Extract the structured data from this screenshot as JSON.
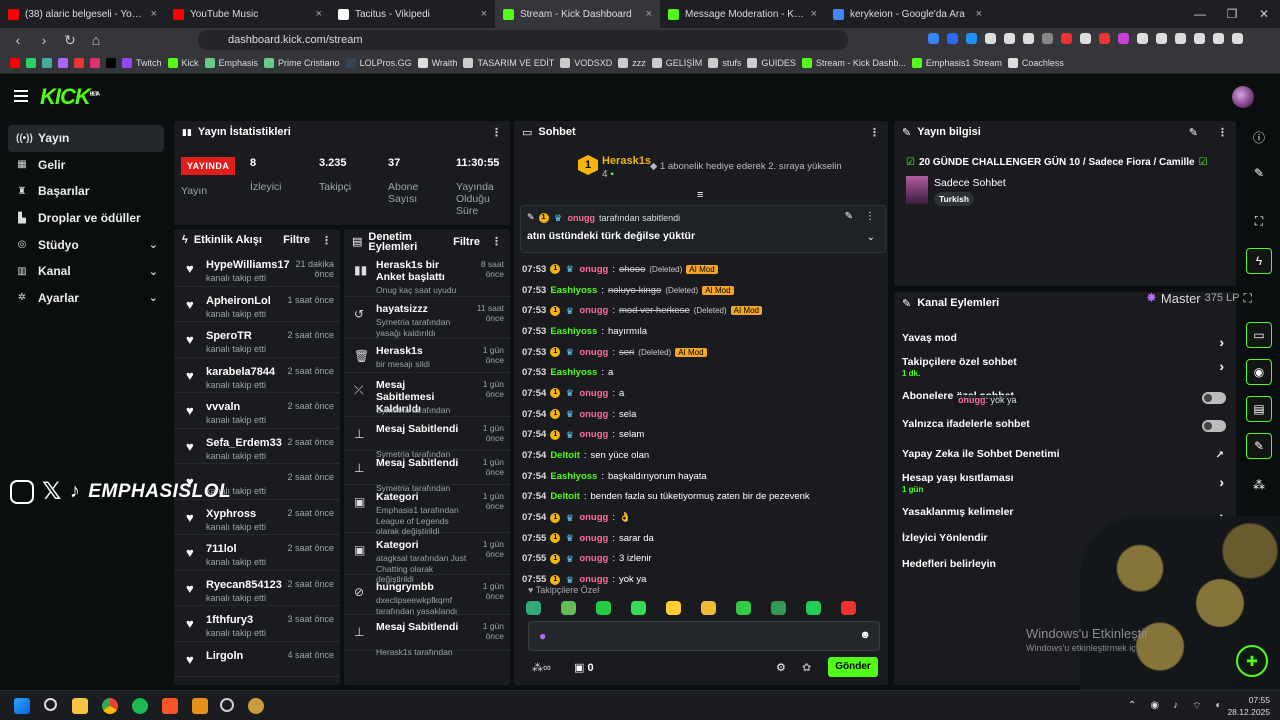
{
  "browser": {
    "tabs": [
      {
        "title": "(38) alaric belgeseli - YouTube",
        "color": "#ff0000"
      },
      {
        "title": "YouTube Music",
        "color": "#ff0000"
      },
      {
        "title": "Tacitus - Vikipedi",
        "color": "#ffffff"
      },
      {
        "title": "Stream - Kick Dashboard",
        "color": "#53fc18"
      },
      {
        "title": "Message Moderation - Kick Dashboard",
        "color": "#53fc18"
      },
      {
        "title": "kerykeion - Google'da Ara",
        "color": "#4285f4"
      }
    ],
    "url": "dashboard.kick.com/stream",
    "bookmarks": [
      "Twitch",
      "Kick",
      "Emphasis",
      "Prime Cristiano",
      "LOLPros.GG",
      "Wraith",
      "TASARIM VE EDİT",
      "VODSXD",
      "zzz",
      "GELİŞİM",
      "stufs",
      "GUIDES",
      "Stream - Kick Dashb...",
      "Emphasis1 Stream",
      "Coachless"
    ]
  },
  "kick": {
    "logo": "KICK",
    "beta": "BETA"
  },
  "sidebar": [
    {
      "label": "Yayın",
      "icon": "broadcast-icon"
    },
    {
      "label": "Gelir",
      "icon": "revenue-icon"
    },
    {
      "label": "Başarılar",
      "icon": "trophy-icon"
    },
    {
      "label": "Droplar ve ödüller",
      "icon": "drops-icon"
    },
    {
      "label": "Stüdyo",
      "icon": "studio-icon"
    },
    {
      "label": "Kanal",
      "icon": "channel-icon"
    },
    {
      "label": "Ayarlar",
      "icon": "gear-icon"
    }
  ],
  "stats": {
    "title": "Yayın İstatistikleri",
    "live_badge": "YAYINDA",
    "live_label": "Yayın",
    "viewers": "8",
    "viewers_label": "İzleyici",
    "followers": "3.235",
    "followers_label": "Takipçi",
    "subs": "37",
    "subs_label": "Abone Sayısı",
    "uptime": "11:30:55",
    "uptime_label": "Yayında Olduğu Süre"
  },
  "activity": {
    "title": "Etkinlik Akışı",
    "filter": "Filtre",
    "rows": [
      {
        "name": "HypeWilliams17",
        "sub": "kanalı takip etti",
        "time": "21 dakika önce"
      },
      {
        "name": "ApheironLol",
        "sub": "kanalı takip etti",
        "time": "1 saat önce"
      },
      {
        "name": "SperoTR",
        "sub": "kanalı takip etti",
        "time": "2 saat önce"
      },
      {
        "name": "karabela7844",
        "sub": "kanalı takip etti",
        "time": "2 saat önce"
      },
      {
        "name": "vvvaln",
        "sub": "kanalı takip etti",
        "time": "2 saat önce"
      },
      {
        "name": "Sefa_Erdem33",
        "sub": "kanalı takip etti",
        "time": "2 saat önce"
      },
      {
        "name": "",
        "sub": "kanalı takip etti",
        "time": "2 saat önce"
      },
      {
        "name": "Xyphross",
        "sub": "kanalı takip etti",
        "time": "2 saat önce"
      },
      {
        "name": "711lol",
        "sub": "kanalı takip etti",
        "time": "2 saat önce"
      },
      {
        "name": "Ryecan854123",
        "sub": "kanalı takip etti",
        "time": "2 saat önce"
      },
      {
        "name": "1fthfury3",
        "sub": "kanalı takip etti",
        "time": "3 saat önce"
      },
      {
        "name": "Lirgoln",
        "sub": "",
        "time": "4 saat önce"
      }
    ]
  },
  "moderation": {
    "title": "Denetim Eylemleri",
    "filter": "Filtre",
    "rows": [
      {
        "icon": "poll-icon",
        "name": "Herask1s bir Anket başlattı",
        "sub": "Onug kaç saat uyudu",
        "time": "8 saat önce"
      },
      {
        "icon": "undo-icon",
        "name": "hayatsizzz",
        "sub": "Symetria tarafından yasağı kaldırıldı",
        "time": "11 saat önce"
      },
      {
        "icon": "trash-icon",
        "name": "Herask1s",
        "sub": "bir mesajı sildi",
        "time": "1 gün önce"
      },
      {
        "icon": "unpin-icon",
        "name": "Mesaj Sabitlemesi Kaldırıldı",
        "sub": "Symetria tarafından",
        "time": "1 gün önce"
      },
      {
        "icon": "pin-icon",
        "name": "Mesaj Sabitlendi",
        "sub": "Symetria tarafından",
        "time": "1 gün önce"
      },
      {
        "icon": "pin-icon",
        "name": "Mesaj Sabitlendi",
        "sub": "Symetria tarafından",
        "time": "1 gün önce"
      },
      {
        "icon": "category-icon",
        "name": "Kategori",
        "sub": "Emphasis1 tarafından League of Legends olarak değiştirildi",
        "time": "1 gün önce"
      },
      {
        "icon": "category-icon",
        "name": "Kategori",
        "sub": "atagksal tarafından Just Chatting olarak değiştirildi",
        "time": "1 gün önce"
      },
      {
        "icon": "ban-icon",
        "name": "hungrymbb",
        "sub": "dxeclipseewkpfkqmf tarafından yasaklandı",
        "time": "1 gün önce"
      },
      {
        "icon": "pin-icon",
        "name": "Mesaj Sabitlendi",
        "sub": "Herask1s tarafından",
        "time": "1 gün önce"
      }
    ]
  },
  "chat": {
    "title": "Sohbet",
    "gift_user": "Herask1s",
    "gift_count": "4",
    "gift_text": "1 abonelik hediye ederek 2. sıraya yükselin",
    "pinned_by": "onugg",
    "pinned_by_suffix": "tarafından sabitlendi",
    "pinned_text": "atın üstündeki türk değilse yüktür",
    "messages": [
      {
        "time": "07:53",
        "user": "onugg",
        "text": "ohooo",
        "deleted": true,
        "ai": true,
        "badges": true
      },
      {
        "time": "07:53",
        "user": "Eashiyoss",
        "text": "noluyo kingo",
        "deleted": true,
        "ai": true,
        "badges": false
      },
      {
        "time": "07:53",
        "user": "onugg",
        "text": "mod ver herkese",
        "deleted": true,
        "ai": true,
        "badges": true
      },
      {
        "time": "07:53",
        "user": "Eashiyoss",
        "text": "hayırmıla",
        "deleted": false,
        "ai": false,
        "badges": false
      },
      {
        "time": "07:53",
        "user": "onugg",
        "text": "seri",
        "deleted": true,
        "ai": true,
        "badges": true
      },
      {
        "time": "07:53",
        "user": "Eashiyoss",
        "text": "a",
        "deleted": false,
        "ai": false,
        "badges": false
      },
      {
        "time": "07:54",
        "user": "onugg",
        "text": "a",
        "deleted": false,
        "ai": false,
        "badges": true
      },
      {
        "time": "07:54",
        "user": "onugg",
        "text": "sela",
        "deleted": false,
        "ai": false,
        "badges": true
      },
      {
        "time": "07:54",
        "user": "onugg",
        "text": "selam",
        "deleted": false,
        "ai": false,
        "badges": true
      },
      {
        "time": "07:54",
        "user": "Deltoit",
        "text": "sen yüce olan",
        "deleted": false,
        "ai": false,
        "badges": false
      },
      {
        "time": "07:54",
        "user": "Eashiyoss",
        "text": "başkaldırıyorum hayata",
        "deleted": false,
        "ai": false,
        "badges": false
      },
      {
        "time": "07:54",
        "user": "Deltoit",
        "text": "benden fazla su tüketiyormuş zaten bir de pezevenk",
        "deleted": false,
        "ai": false,
        "badges": false
      },
      {
        "time": "07:54",
        "user": "onugg",
        "text": "👌",
        "deleted": false,
        "ai": false,
        "badges": true
      },
      {
        "time": "07:55",
        "user": "onugg",
        "text": "sarar da",
        "deleted": false,
        "ai": false,
        "badges": true
      },
      {
        "time": "07:55",
        "user": "onugg",
        "text": "3 izlenir",
        "deleted": false,
        "ai": false,
        "badges": true
      },
      {
        "time": "07:55",
        "user": "onugg",
        "text": "yok ya",
        "deleted": false,
        "ai": false,
        "badges": true
      }
    ],
    "deleted_tag": "(Deleted)",
    "ai_tag": "AI Mod",
    "followers_only": "Takipçilere Özel",
    "points": "0",
    "send": "Gönder"
  },
  "stream_info": {
    "title": "Yayın bilgisi",
    "stream_title": "20 GÜNDE CHALLENGER GÜN 10 / Sadece Fiora / Camille",
    "category": "Sadece Sohbet",
    "tag": "Turkish"
  },
  "channel_actions": {
    "title": "Kanal Eylemleri",
    "rows": [
      {
        "label": "Yavaş mod",
        "sub": "",
        "control": "arrow"
      },
      {
        "label": "Takipçilere özel sohbet",
        "sub": "1 dk.",
        "control": "arrow"
      },
      {
        "label": "Abonelere özel sohbet",
        "sub": "",
        "control": "toggle"
      },
      {
        "label": "Yalnızca ifadelerle sohbet",
        "sub": "",
        "control": "toggle"
      },
      {
        "label": "Yapay Zeka ile Sohbet Denetimi",
        "sub": "",
        "control": "external"
      },
      {
        "label": "Hesap yaşı kısıtlaması",
        "sub": "1 gün",
        "control": "arrow"
      },
      {
        "label": "Yasaklanmış kelimeler",
        "sub": "",
        "control": "arrow"
      },
      {
        "label": "İzleyici Yönlendir",
        "sub": "",
        "control": "none"
      },
      {
        "label": "Hedefleri belirleyin",
        "sub": "",
        "control": "none"
      }
    ]
  },
  "overlay": {
    "brand": "EMPHASISLOL",
    "rank": "Master",
    "lp": "375 LP",
    "ghost_user": "onugg",
    "ghost_msg": ": yok ya",
    "activate_title": "Windows'u Etkinleştir",
    "activate_sub": "Windows'u etkinleştirmek için Ayarlar'a gidin."
  },
  "taskbar": {
    "time": "07:55",
    "date": "28.12.2025"
  }
}
